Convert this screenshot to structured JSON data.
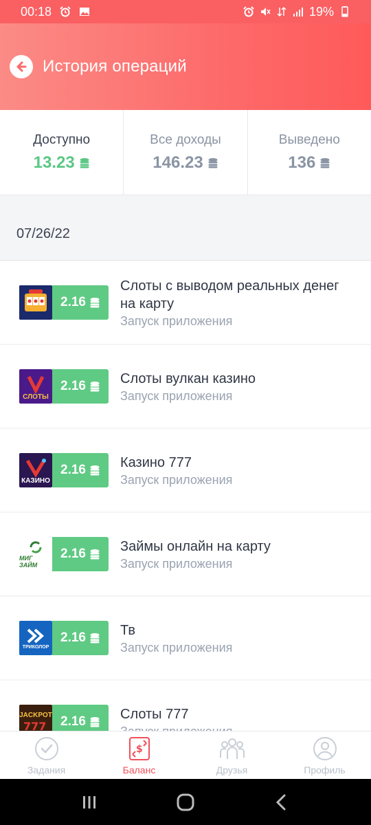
{
  "status_bar": {
    "time": "00:18",
    "battery": "19%"
  },
  "header": {
    "title": "История операций"
  },
  "stats": [
    {
      "label": "Доступно",
      "value": "13.23"
    },
    {
      "label": "Все доходы",
      "value": "146.23"
    },
    {
      "label": "Выведено",
      "value": "136"
    }
  ],
  "date": "07/26/22",
  "items": [
    {
      "logo_text": "",
      "amount": "2.16",
      "title": "Слоты с выводом реальных денег на карту",
      "subtitle": "Запуск приложения"
    },
    {
      "logo_text": "СЛОТЫ",
      "amount": "2.16",
      "title": "Слоты вулкан казино",
      "subtitle": "Запуск приложения"
    },
    {
      "logo_text": "КАЗИНО",
      "amount": "2.16",
      "title": "Казино 777",
      "subtitle": "Запуск приложения"
    },
    {
      "logo_text": "МИГ ЗАЙМ",
      "amount": "2.16",
      "title": "Займы онлайн на карту",
      "subtitle": "Запуск приложения"
    },
    {
      "logo_text": "ТРИКОЛОР",
      "amount": "2.16",
      "title": "Тв",
      "subtitle": "Запуск приложения"
    },
    {
      "logo_text": "JACKPOT",
      "amount": "2.16",
      "title": "Слоты 777",
      "subtitle": "Запуск приложения"
    }
  ],
  "nav": [
    {
      "label": "Задания",
      "icon": "check-circle-icon"
    },
    {
      "label": "Баланс",
      "icon": "balance-exchange-icon"
    },
    {
      "label": "Друзья",
      "icon": "friends-icon"
    },
    {
      "label": "Профиль",
      "icon": "profile-icon"
    }
  ],
  "colors": {
    "accent": "#fd6a6a",
    "green": "#5fca83",
    "active_nav": "#f0505a"
  }
}
